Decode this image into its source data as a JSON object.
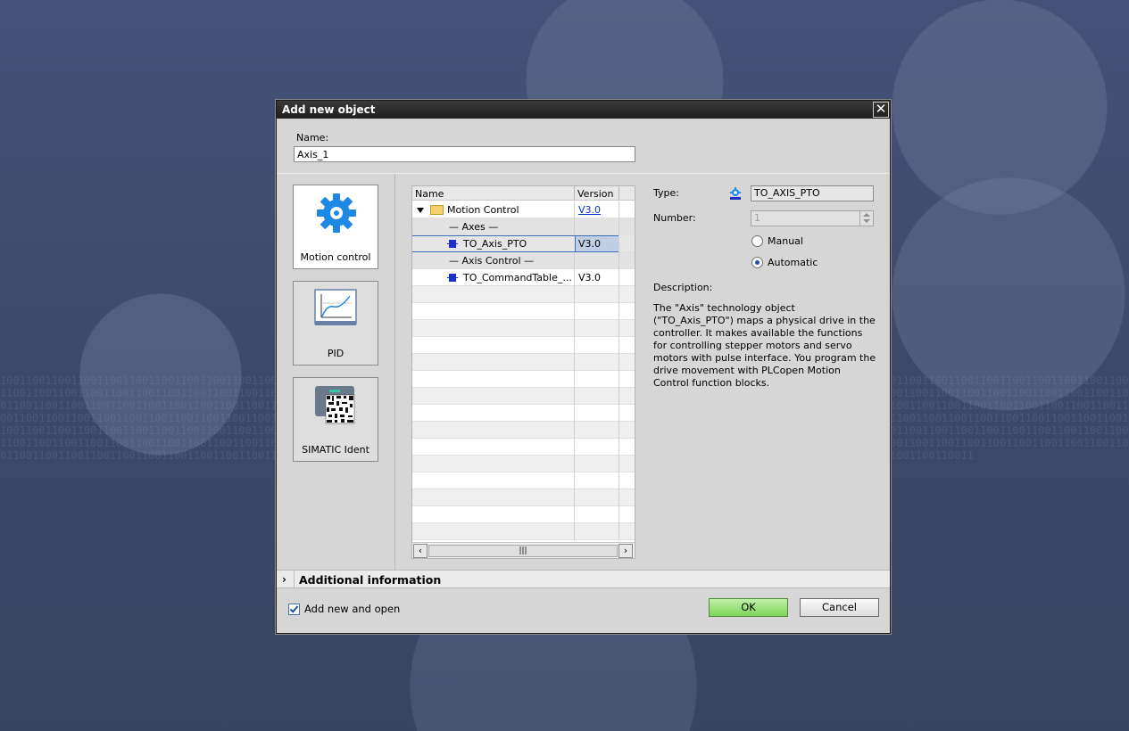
{
  "dialog": {
    "title": "Add new object",
    "name_label": "Name:",
    "name_value": "Axis_1"
  },
  "categories": [
    {
      "label": "Motion control",
      "icon": "gear-icon"
    },
    {
      "label": "PID",
      "icon": "pid-chart-icon"
    },
    {
      "label": "SIMATIC Ident",
      "icon": "rfid-reader-icon"
    }
  ],
  "tree": {
    "col_name": "Name",
    "col_version": "Version",
    "rows": [
      {
        "label": "Motion Control",
        "version": "V3.0"
      },
      {
        "label": "— Axes —",
        "version": ""
      },
      {
        "label": "TO_Axis_PTO",
        "version": "V3.0"
      },
      {
        "label": "— Axis Control —",
        "version": ""
      },
      {
        "label": "TO_CommandTable_...",
        "version": "V3.0"
      }
    ],
    "scroll_thumb": "|||"
  },
  "details": {
    "type_label": "Type:",
    "type_value": "TO_AXIS_PTO",
    "number_label": "Number:",
    "number_value": "1",
    "manual_label": "Manual",
    "automatic_label": "Automatic",
    "description_label": "Description:",
    "description": "The \"Axis\" technology object (\"TO_Axis_PTO\") maps a physical drive in the controller. It makes available the functions for controlling stepper motors and servo motors with pulse interface. You program the drive movement with PLCopen Motion Control function blocks."
  },
  "additional_information": "Additional  information",
  "footer": {
    "add_new_and_open": "Add new and open",
    "ok": "OK",
    "cancel": "Cancel"
  },
  "colors": {
    "ok_button": "#7ed65a",
    "title_bar": "#1e1e1e",
    "selection": "#c0cfe6",
    "link": "#0033cc"
  }
}
